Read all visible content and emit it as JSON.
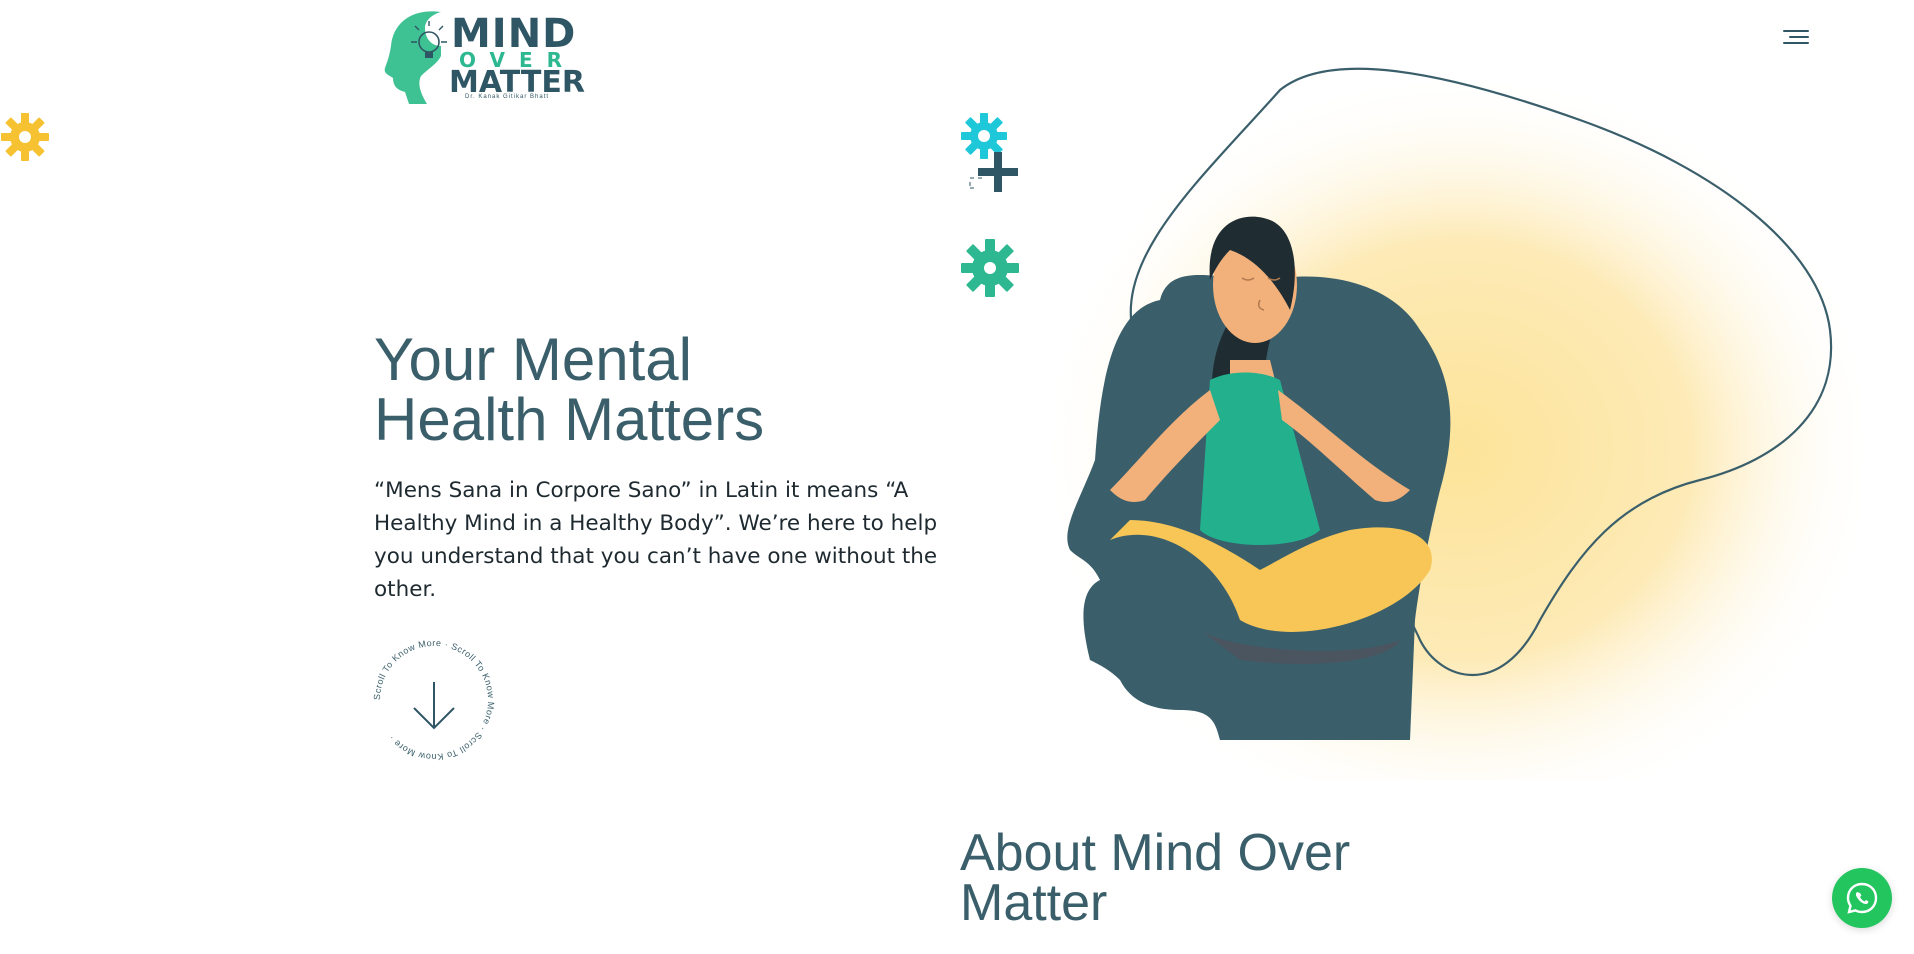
{
  "logo": {
    "word1": "MIND",
    "word2": "OVER",
    "word3": "MATTER",
    "subtitle": "Dr. Kanak Gitikar Bhatt"
  },
  "nav": {
    "menu_icon": "hamburger-menu-icon"
  },
  "hero": {
    "title_line1": "Your Mental",
    "title_line2": "Health Matters",
    "text": "“Mens Sana in Corpore Sano” in Latin it means “A Healthy Mind in a Healthy Body”. We’re here to help you understand that you can’t have one without the other.",
    "scroll_label": "Scroll To Know More · Scroll To Know More · Scroll To Know More ·"
  },
  "about": {
    "title_line1": "About Mind Over",
    "title_line2": "Matter"
  },
  "whatsapp": {
    "icon": "whatsapp-icon"
  },
  "colors": {
    "primary": "#3a5f6b",
    "accent_green": "#2eb891",
    "accent_cyan": "#1ec8d8",
    "accent_yellow": "#f7c232",
    "whatsapp_green": "#22c55e"
  }
}
